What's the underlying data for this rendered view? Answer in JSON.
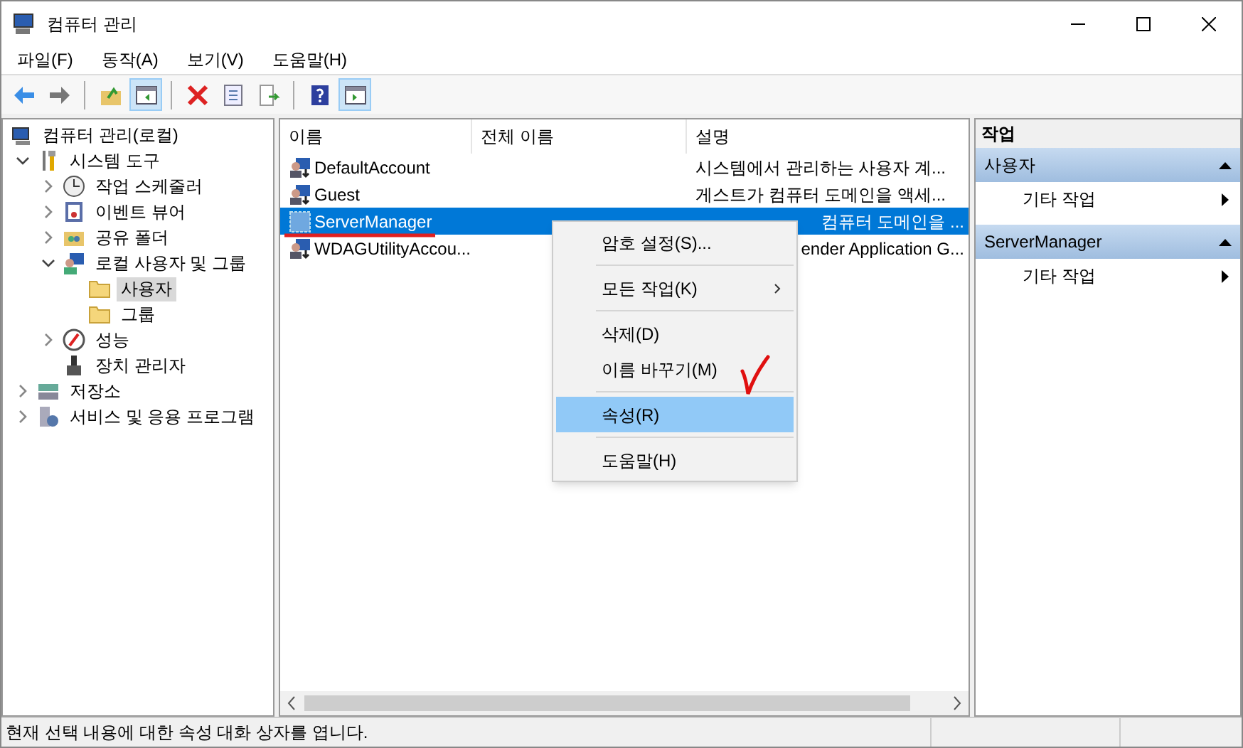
{
  "window": {
    "title": "컴퓨터 관리"
  },
  "menu": [
    "파일(F)",
    "동작(A)",
    "보기(V)",
    "도움말(H)"
  ],
  "toolbar": [
    {
      "kind": "back"
    },
    {
      "kind": "forward"
    },
    {
      "kind": "sep"
    },
    {
      "kind": "up",
      "selected": false
    },
    {
      "kind": "pane-left",
      "selected": true
    },
    {
      "kind": "sep"
    },
    {
      "kind": "delete"
    },
    {
      "kind": "properties"
    },
    {
      "kind": "export"
    },
    {
      "kind": "sep"
    },
    {
      "kind": "help"
    },
    {
      "kind": "pane-right",
      "selected": true
    }
  ],
  "tree": [
    {
      "label": "컴퓨터 관리(로컬)",
      "kind": "computer",
      "selected": false,
      "children": [
        {
          "label": "시스템 도구",
          "kind": "tools",
          "expanded": true,
          "selected": false,
          "children": [
            {
              "label": "작업 스케줄러",
              "kind": "clock",
              "expanded": false,
              "selected": false
            },
            {
              "label": "이벤트 뷰어",
              "kind": "log",
              "expanded": false,
              "selected": false
            },
            {
              "label": "공유 폴더",
              "kind": "share",
              "expanded": false,
              "selected": false
            },
            {
              "label": "로컬 사용자 및 그룹",
              "kind": "users",
              "expanded": true,
              "selected": false,
              "children": [
                {
                  "label": "사용자",
                  "kind": "folder",
                  "selected": true
                },
                {
                  "label": "그룹",
                  "kind": "folder",
                  "selected": false
                }
              ]
            },
            {
              "label": "성능",
              "kind": "gauge",
              "expanded": false,
              "selected": false
            },
            {
              "label": "장치 관리자",
              "kind": "device",
              "selected": false
            }
          ]
        },
        {
          "label": "저장소",
          "kind": "storage",
          "expanded": false,
          "selected": false
        },
        {
          "label": "서비스 및 응용 프로그램",
          "kind": "services",
          "expanded": false,
          "selected": false
        }
      ]
    }
  ],
  "table": {
    "columns": [
      "이름",
      "전체 이름",
      "설명"
    ],
    "rows": [
      {
        "name": "DefaultAccount",
        "description": "시스템에서 관리하는 사용자 계...",
        "selected": false,
        "covered": false
      },
      {
        "name": "Guest",
        "description": "게스트가 컴퓨터 도메인을 액세...",
        "selected": false,
        "covered": false
      },
      {
        "name": "ServerManager",
        "description": "컴퓨터 도메인을 ...",
        "selected": true,
        "covered": true
      },
      {
        "name": "WDAGUtilityAccou...",
        "description": "ender Application G...",
        "selected": false,
        "covered": true
      }
    ]
  },
  "context_menu": [
    {
      "kind": "item",
      "label": "암호 설정(S)...",
      "highlighted": false,
      "submenu": false
    },
    {
      "kind": "sep"
    },
    {
      "kind": "item",
      "label": "모든 작업(K)",
      "highlighted": false,
      "submenu": true
    },
    {
      "kind": "sep"
    },
    {
      "kind": "item",
      "label": "삭제(D)",
      "highlighted": false,
      "submenu": false
    },
    {
      "kind": "item",
      "label": "이름 바꾸기(M)",
      "highlighted": false,
      "submenu": false
    },
    {
      "kind": "sep"
    },
    {
      "kind": "item",
      "label": "속성(R)",
      "highlighted": true,
      "submenu": false
    },
    {
      "kind": "sep"
    },
    {
      "kind": "item",
      "label": "도움말(H)",
      "highlighted": false,
      "submenu": false
    }
  ],
  "actions": {
    "title": "작업",
    "sections": [
      {
        "title": "사용자",
        "items": [
          "기타 작업"
        ]
      },
      {
        "title": "ServerManager",
        "items": [
          "기타 작업"
        ]
      }
    ]
  },
  "status_bar": "현재 선택 내용에 대한 속성 대화 상자를 엽니다."
}
